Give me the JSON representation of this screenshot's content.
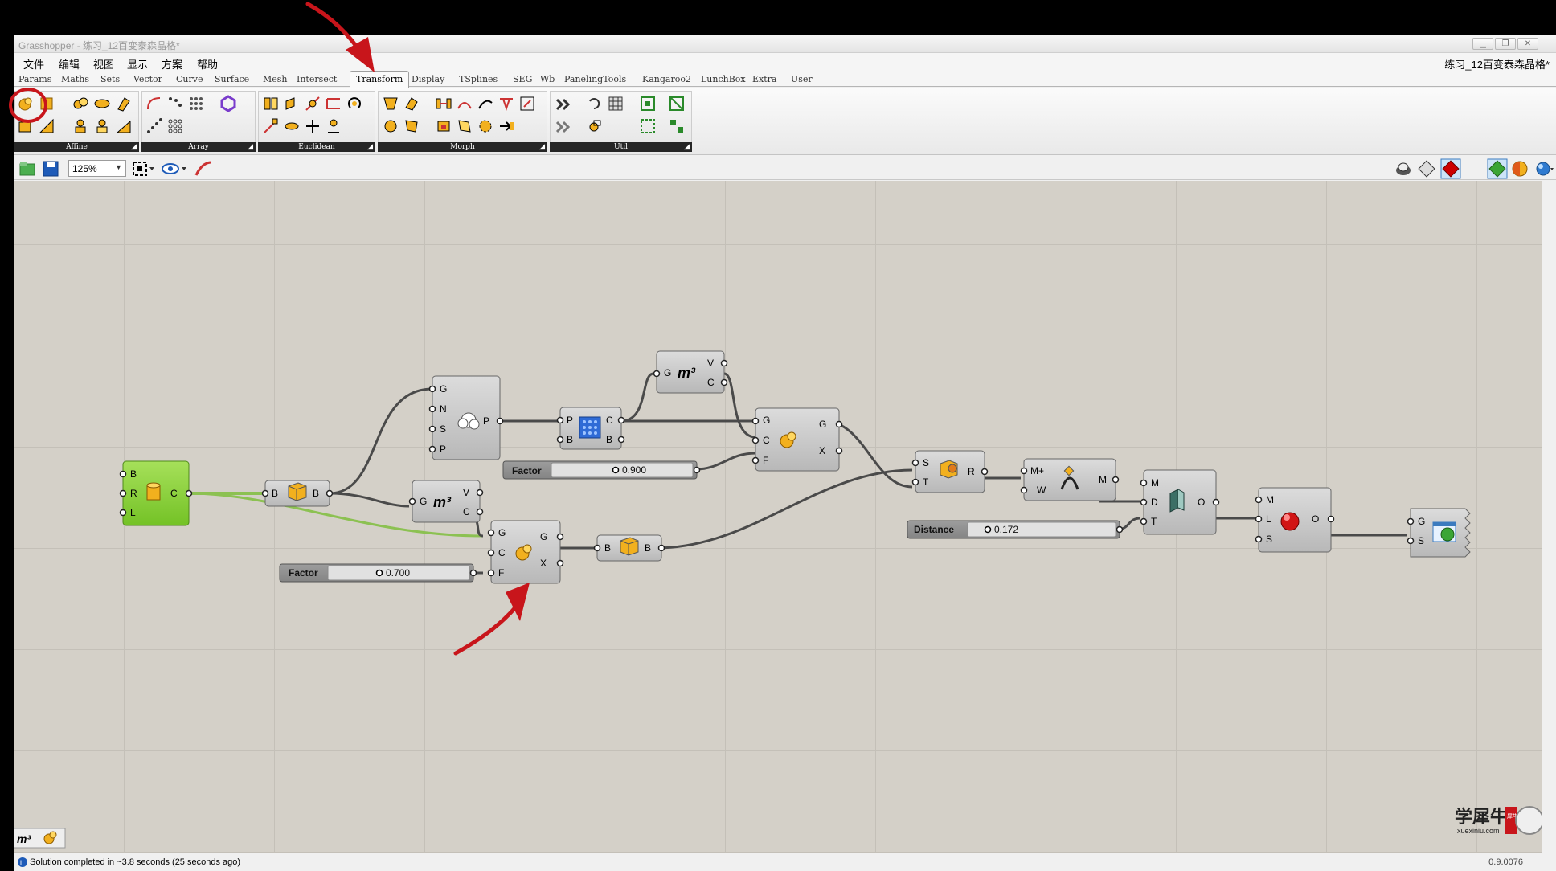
{
  "window": {
    "title": "Grasshopper - 练习_12百变泰森晶格*",
    "document_name": "练习_12百变泰森晶格*",
    "minimize": "▁",
    "restore": "❐",
    "close": "✕"
  },
  "menu": [
    "文件",
    "编辑",
    "视图",
    "显示",
    "方案",
    "帮助"
  ],
  "tabs": [
    "Params",
    "Maths",
    "Sets",
    "Vector",
    "Curve",
    "Surface",
    "Mesh",
    "Intersect",
    "Transform",
    "Display",
    "TSplines",
    "SEG",
    "Wb",
    "PanelingTools",
    "Kangaroo2",
    "LunchBox",
    "Extra",
    "User"
  ],
  "ribbon_groups": [
    "Affine",
    "Array",
    "Euclidean",
    "Morph",
    "Util"
  ],
  "ribbon_expand": "◢",
  "zoom": "125%",
  "nodes": {
    "brep_param": {
      "inputs": [
        "B",
        "R",
        "L"
      ],
      "outputs": [
        "C"
      ]
    },
    "box1": {
      "inputs": [
        "B"
      ],
      "outputs": [
        "B"
      ]
    },
    "populate": {
      "inputs": [
        "G",
        "N",
        "S",
        "P"
      ],
      "outputs": [
        "P"
      ]
    },
    "voronoi": {
      "inputs": [
        "P",
        "B"
      ],
      "outputs": [
        "C",
        "B"
      ]
    },
    "volume1": {
      "inputs": [
        "G"
      ],
      "outputs": [
        "V",
        "C"
      ],
      "symbol": "m³"
    },
    "volume2": {
      "inputs": [
        "G"
      ],
      "outputs": [
        "V",
        "C"
      ],
      "symbol": "m³"
    },
    "scale1": {
      "inputs": [
        "G",
        "C",
        "F"
      ],
      "outputs": [
        "G",
        "X"
      ]
    },
    "scale2": {
      "inputs": [
        "G",
        "C",
        "F"
      ],
      "outputs": [
        "G",
        "X"
      ]
    },
    "box2": {
      "inputs": [
        "B"
      ],
      "outputs": [
        "B"
      ]
    },
    "solid_union": {
      "inputs": [
        "S",
        "T"
      ],
      "outputs": [
        "R"
      ]
    },
    "mesh_join": {
      "inputs": [
        "M+",
        "W"
      ],
      "outputs": [
        "M"
      ]
    },
    "offset_mesh": {
      "inputs": [
        "M",
        "D",
        "T"
      ],
      "outputs": [
        "O"
      ]
    },
    "smooth": {
      "inputs": [
        "M",
        "L",
        "S"
      ],
      "outputs": [
        "O"
      ]
    },
    "preview": {
      "inputs": [
        "G",
        "S"
      ],
      "outputs": []
    }
  },
  "sliders": {
    "factor1": {
      "label": "Factor",
      "value": "0.900"
    },
    "factor2": {
      "label": "Factor",
      "value": "0.700"
    },
    "distance": {
      "label": "Distance",
      "value": "0.172"
    }
  },
  "watermark": {
    "text": "学犀牛",
    "url": "xuexiniu.com",
    "seal": "犀牛"
  },
  "status": {
    "message": "Solution completed in ~3.8 seconds (25 seconds ago)",
    "version": "0.9.0076"
  },
  "colors": {
    "canvas": "#d4d0c8",
    "node": "#c8c8c8",
    "selected_node": "#8ed63a",
    "annotation": "#c8151b",
    "wire": "#4a4a4a",
    "selected_wire": "#8cc152"
  }
}
